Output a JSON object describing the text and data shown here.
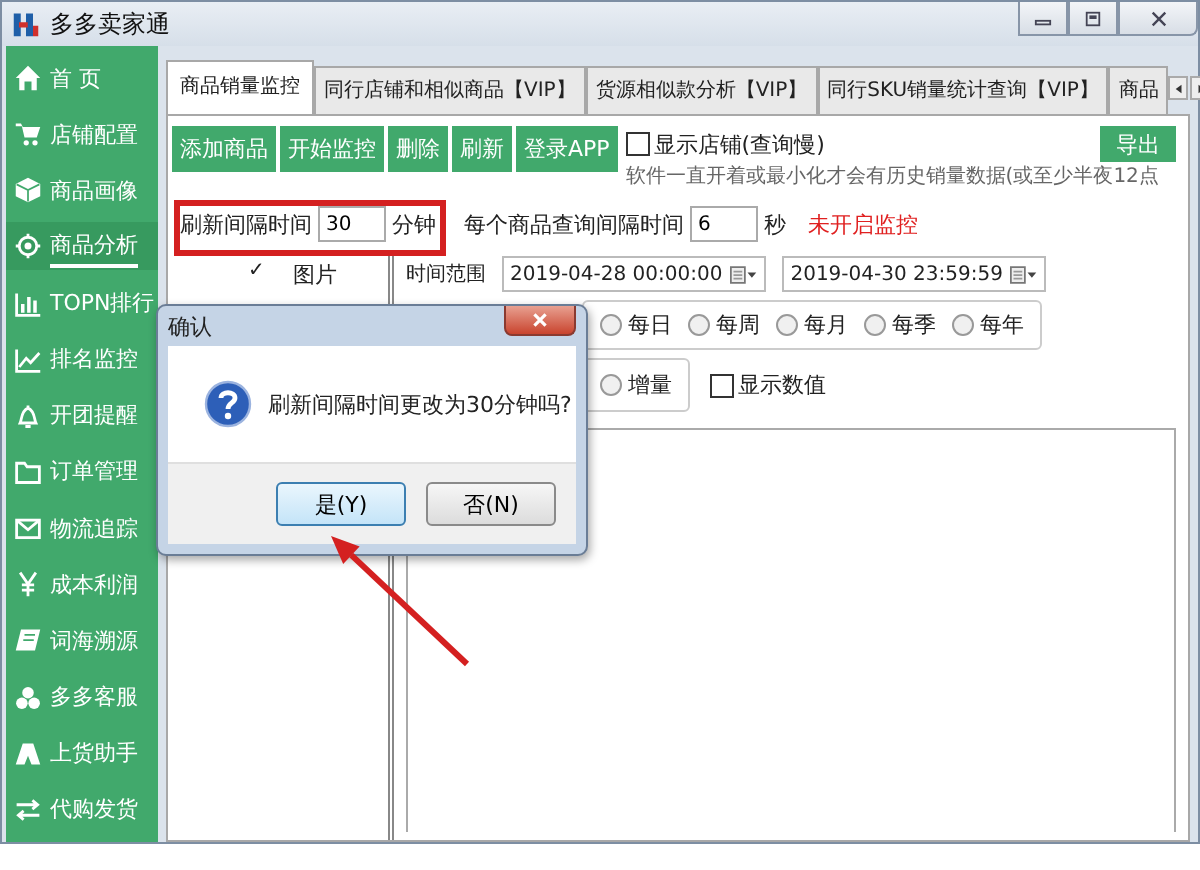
{
  "window": {
    "title": "多多卖家通"
  },
  "sidebar": {
    "items": [
      {
        "label": "首  页",
        "kind": "home",
        "selected": false
      },
      {
        "label": "店铺配置",
        "kind": "cart",
        "selected": false
      },
      {
        "label": "商品画像",
        "kind": "cube",
        "selected": false
      },
      {
        "label": "商品分析",
        "kind": "gear",
        "selected": true
      },
      {
        "label": "TOPN排行",
        "kind": "bars",
        "selected": false
      },
      {
        "label": "排名监控",
        "kind": "trend",
        "selected": false
      },
      {
        "label": "开团提醒",
        "kind": "bell",
        "selected": false
      },
      {
        "label": "订单管理",
        "kind": "folder",
        "selected": false
      },
      {
        "label": "物流追踪",
        "kind": "mail",
        "selected": false
      },
      {
        "label": "成本利润",
        "kind": "yen",
        "selected": false
      },
      {
        "label": "词海溯源",
        "kind": "book",
        "selected": false
      },
      {
        "label": "多多客服",
        "kind": "circles",
        "selected": false
      },
      {
        "label": "上货助手",
        "kind": "tent",
        "selected": false
      },
      {
        "label": "代购发货",
        "kind": "swap",
        "selected": false
      }
    ]
  },
  "tabs": [
    {
      "label": "商品销量监控",
      "selected": true
    },
    {
      "label": "同行店铺和相似商品【VIP】",
      "selected": false
    },
    {
      "label": "货源相似款分析【VIP】",
      "selected": false
    },
    {
      "label": "同行SKU销量统计查询【VIP】",
      "selected": false
    },
    {
      "label": "商品",
      "selected": false
    }
  ],
  "toolbar": {
    "buttons": [
      "添加商品",
      "开始监控",
      "删除",
      "刷新",
      "登录APP"
    ],
    "show_shop": {
      "label": "显示店铺(查询慢)",
      "checked": false
    },
    "export_button": "导出",
    "note": "软件一直开着或最小化才会有历史销量数据(或至少半夜12点"
  },
  "settings": {
    "refresh_label": "刷新间隔时间",
    "refresh_value": "30",
    "refresh_unit": "分钟",
    "query_label": "每个商品查询间隔时间",
    "query_value": "6",
    "query_unit": "秒",
    "status": "未开启监控"
  },
  "list_header": {
    "mark": "✓",
    "label": "图片"
  },
  "time_range": {
    "label": "时间范围",
    "start": "2019-04-28 00:00:00",
    "end": "2019-04-30 23:59:59"
  },
  "periods": [
    {
      "label": "每日",
      "selected": false
    },
    {
      "label": "每周",
      "selected": false
    },
    {
      "label": "每月",
      "selected": false
    },
    {
      "label": "每季",
      "selected": false
    },
    {
      "label": "每年",
      "selected": false
    }
  ],
  "mode": {
    "label": "增量",
    "selected": false
  },
  "show_values": {
    "label": "显示数值",
    "checked": false
  },
  "dialog": {
    "title": "确认",
    "message": "刷新间隔时间更改为30分钟吗?",
    "buttons": [
      {
        "label": "是(Y)",
        "selected": true
      },
      {
        "label": "否(N)",
        "selected": false
      }
    ]
  },
  "annotations": {
    "highlight_box": true,
    "arrow": true
  }
}
